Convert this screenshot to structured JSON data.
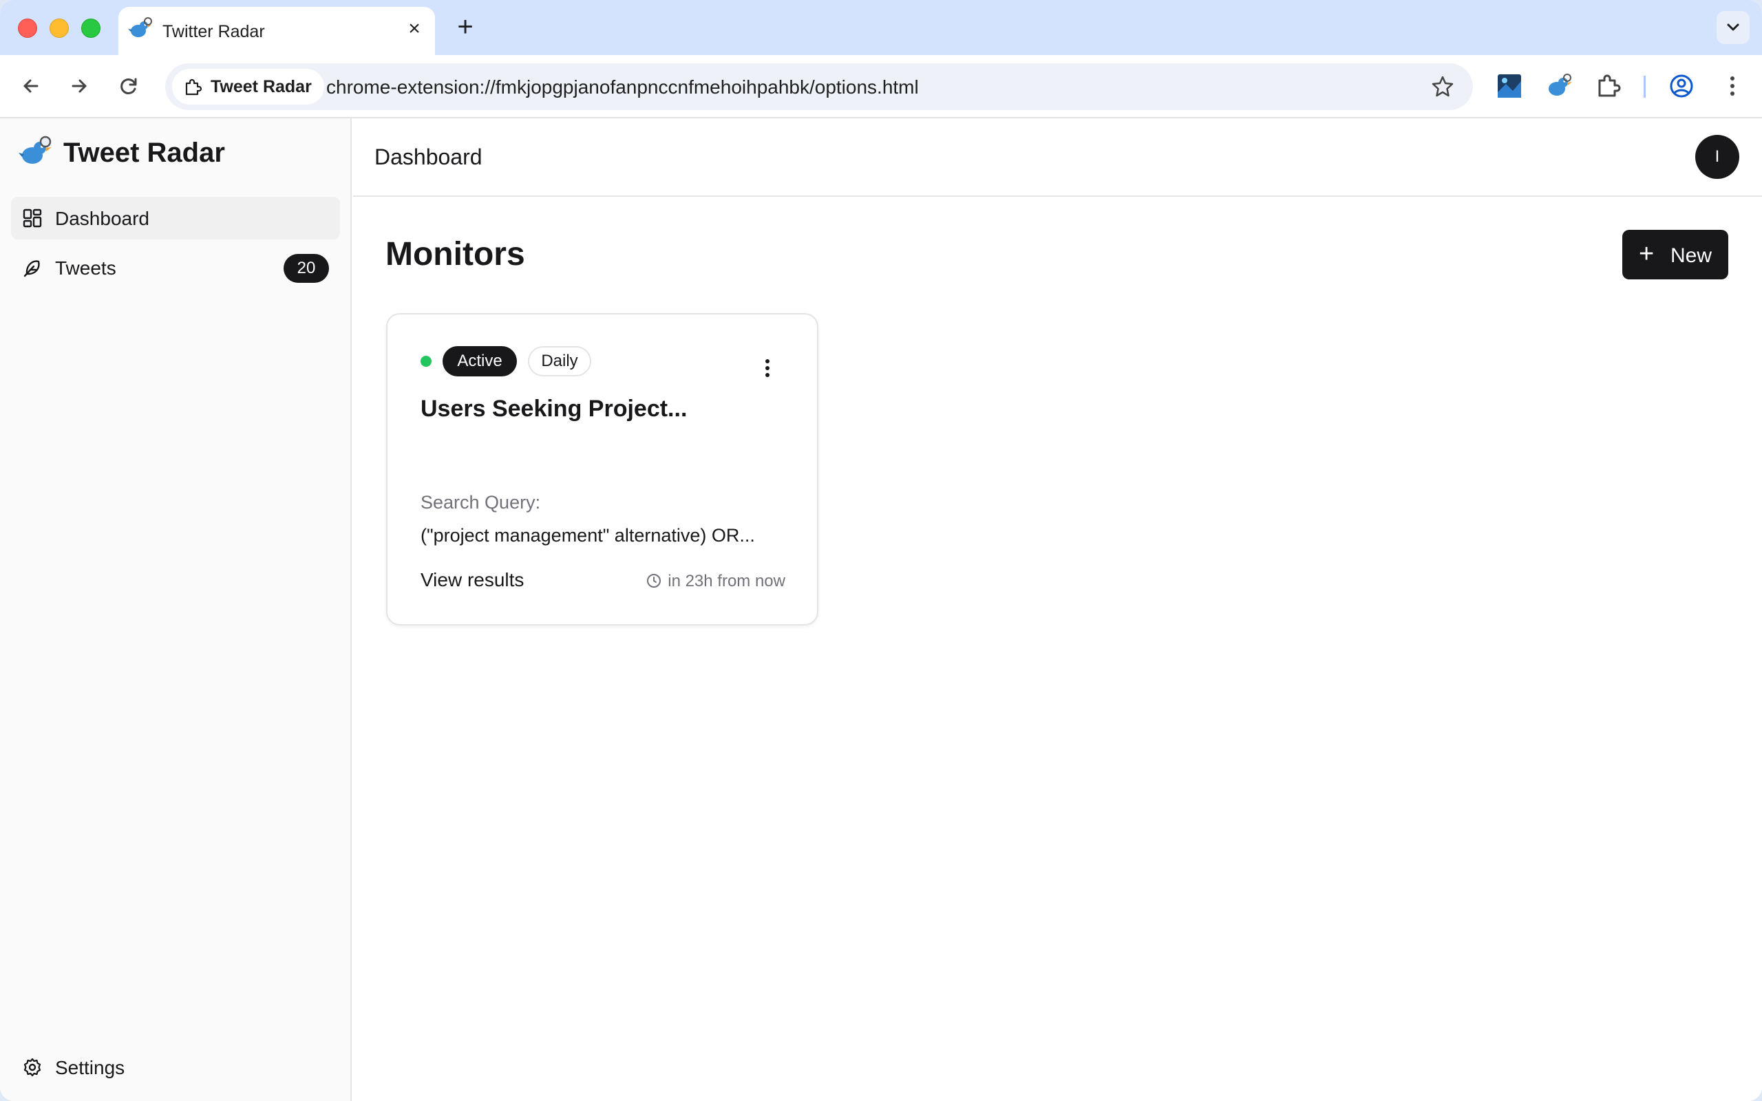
{
  "browser": {
    "tab_title": "Twitter Radar",
    "close_glyph": "×",
    "new_tab_glyph": "+",
    "site_chip_label": "Tweet Radar",
    "url": "chrome-extension://fmkjopgpjanofanpnccnfmehoihpahbk/options.html"
  },
  "sidebar": {
    "brand_name": "Tweet Radar",
    "items": [
      {
        "label": "Dashboard",
        "icon": "dashboard-icon",
        "active": true
      },
      {
        "label": "Tweets",
        "icon": "feather-icon",
        "badge": "20"
      }
    ],
    "settings_label": "Settings"
  },
  "header": {
    "title": "Dashboard",
    "avatar_initial": "I"
  },
  "main": {
    "section_title": "Monitors",
    "new_button_label": "New",
    "new_button_glyph": "+"
  },
  "monitor": {
    "status": "Active",
    "frequency": "Daily",
    "title": "Users Seeking Project...",
    "query_label": "Search Query:",
    "query": "(\"project management\" alternative) OR...",
    "view_results_label": "View results",
    "next_run": "in 23h from now"
  },
  "colors": {
    "accent": "#18181b",
    "status_active": "#22c55e",
    "tabstrip": "#d3e3fd",
    "brand_bird": "#3b8fd9"
  }
}
